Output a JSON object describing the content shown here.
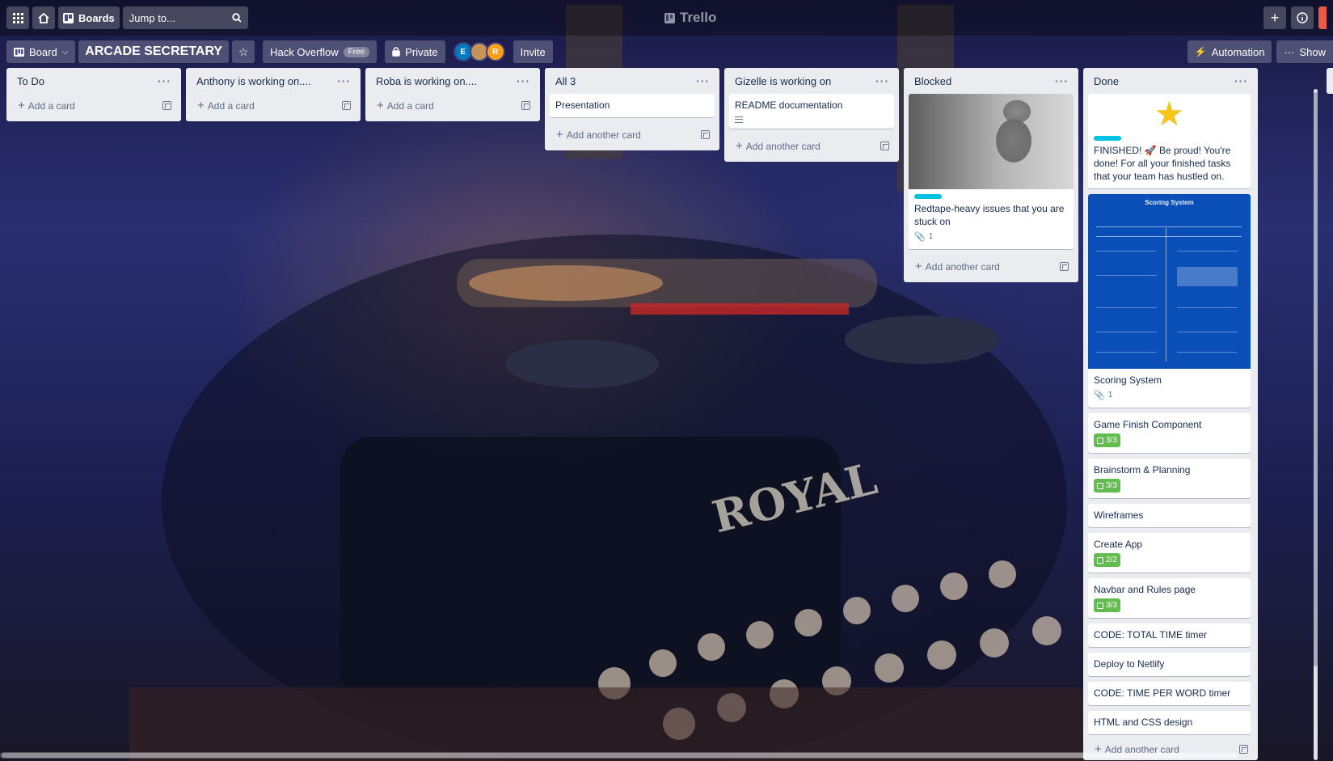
{
  "header": {
    "boards_label": "Boards",
    "search_placeholder": "Jump to...",
    "logo_text": "Trello"
  },
  "board": {
    "view_label": "Board",
    "title": "ARCADE SECRETARY",
    "workspace": "Hack Overflow",
    "workspace_plan": "Free",
    "visibility": "Private",
    "members": [
      {
        "initial": "E",
        "color": "#0079bf"
      },
      {
        "initial": "",
        "color": "#c6935a"
      },
      {
        "initial": "R",
        "color": "#ff9f1a"
      }
    ],
    "invite_label": "Invite",
    "automation_label": "Automation",
    "show_menu_label": "Show"
  },
  "lists": [
    {
      "title": "To Do",
      "add_label": "Add a card"
    },
    {
      "title": "Anthony is working on....",
      "add_label": "Add a card"
    },
    {
      "title": "Roba is working on....",
      "add_label": "Add a card"
    },
    {
      "title": "All 3",
      "add_label": "Add another card",
      "cards": [
        {
          "title": "Presentation"
        }
      ]
    },
    {
      "title": "Gizelle is working on",
      "add_label": "Add another card",
      "cards": [
        {
          "title": "README documentation"
        }
      ]
    },
    {
      "title": "Blocked",
      "add_label": "Add another card",
      "cards": [
        {
          "title": "Redtape-heavy issues that you are stuck on",
          "attachments": "1"
        }
      ]
    },
    {
      "title": "Done",
      "add_label": "Add another card",
      "cards": [
        {
          "title": "FINISHED! 🚀 Be proud! You're done! For all your finished tasks that your team has hustled on."
        },
        {
          "title": "Scoring System",
          "attachments": "1",
          "image_caption": "Scoring System"
        },
        {
          "title": "Game Finish Component",
          "checklist": "3/3"
        },
        {
          "title": "Brainstorm & Planning",
          "checklist": "3/3"
        },
        {
          "title": "Wireframes"
        },
        {
          "title": "Create App",
          "checklist": "2/2"
        },
        {
          "title": "Navbar and Rules page",
          "checklist": "3/3"
        },
        {
          "title": "CODE: TOTAL TIME timer"
        },
        {
          "title": "Deploy to Netlify"
        },
        {
          "title": "CODE: TIME PER WORD timer"
        },
        {
          "title": "HTML and CSS design"
        }
      ]
    }
  ]
}
